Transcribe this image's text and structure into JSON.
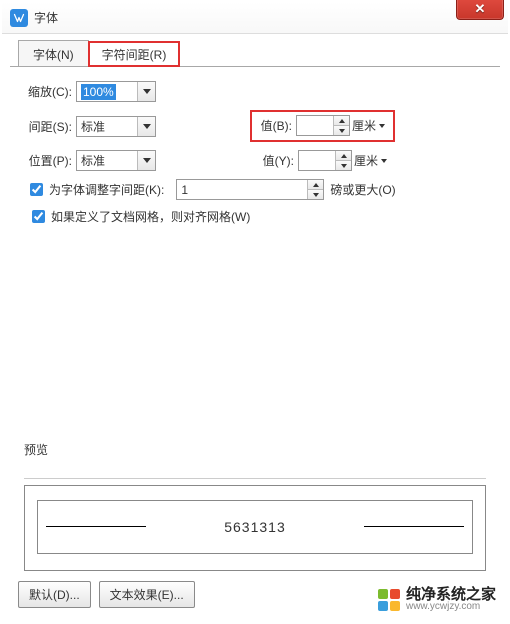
{
  "window": {
    "title": "字体"
  },
  "tabs": {
    "font": "字体(N)",
    "char_spacing": "字符间距(R)"
  },
  "fields": {
    "zoom": {
      "label": "缩放(C):",
      "value": "100%"
    },
    "spacing": {
      "label": "间距(S):",
      "value": "标准",
      "value_b_label": "值(B):",
      "value_b": "",
      "unit_b": "厘米"
    },
    "position": {
      "label": "位置(P):",
      "value": "标准",
      "value_y_label": "值(Y):",
      "value_y": "",
      "unit_y": "厘米"
    },
    "kerning": {
      "label": "为字体调整字间距(K):",
      "value": "1",
      "suffix": "磅或更大(O)"
    },
    "snap": {
      "label": "如果定义了文档网格，则对齐网格(W)"
    }
  },
  "preview": {
    "legend": "预览",
    "sample": "5631313"
  },
  "buttons": {
    "default": "默认(D)...",
    "text_effects": "文本效果(E)..."
  },
  "watermark": {
    "zh": "纯净系统之家",
    "en": "www.ycwjzy.com"
  }
}
